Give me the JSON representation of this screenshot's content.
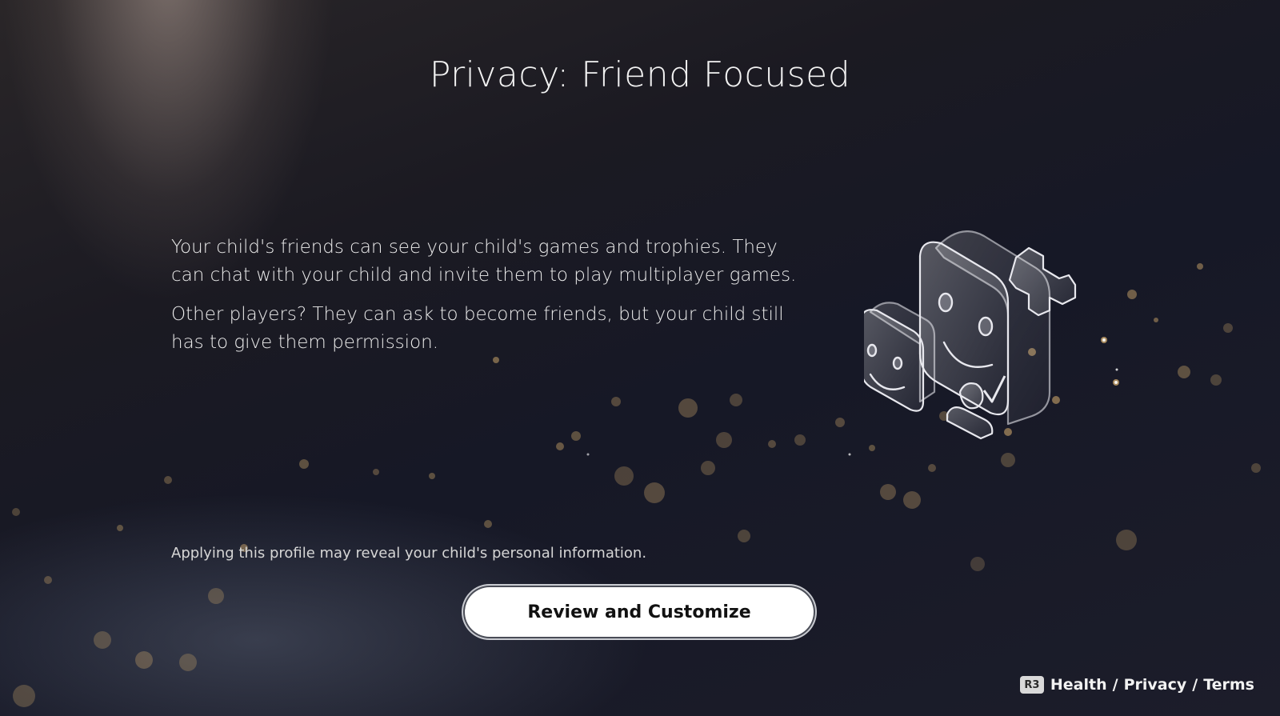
{
  "screen": {
    "title": "Privacy: Friend Focused",
    "paragraphs": [
      "Your child's friends can see your child's games and trophies. They can chat with your child and invite them to play multiplayer games.",
      "Other players? They can ask to become friends, but your child still has to give them permission."
    ],
    "disclaimer": "Applying this profile may reveal your child's personal information.",
    "primary_button": "Review and Customize"
  },
  "footer": {
    "button_badge": "R3",
    "links": [
      "Health",
      "Privacy",
      "Terms"
    ],
    "separator": "/"
  },
  "illustration": {
    "icon": "friends-faces-plus-icon"
  },
  "colors": {
    "background_dark": "#161826",
    "button_bg": "#ffffff",
    "button_text": "#111111",
    "particle_gold": "#c9a46a"
  }
}
